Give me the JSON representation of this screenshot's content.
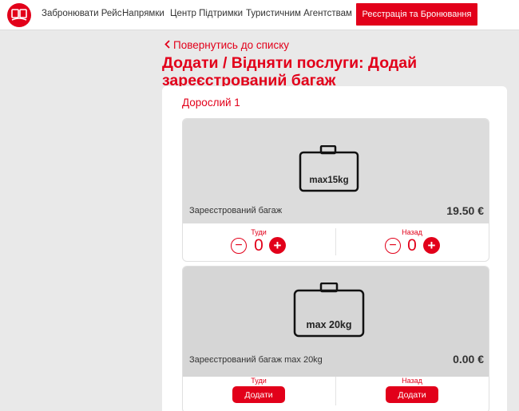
{
  "header": {
    "nav": [
      "Забронювати Рейс",
      "Напрямки",
      "Центр Підтримки",
      "Туристичним Агентствам"
    ],
    "register_button": "Реєстрація та Бронювання",
    "brand_color": "#e2001a"
  },
  "back_link": "Повернутись до списку",
  "page_title": "Додати / Відняти послуги: Додай зареєстрований багаж",
  "passenger_label": "Дорослий 1",
  "bags": [
    {
      "weight_label": "max15kg",
      "name": "Зареєстрований багаж",
      "price": "19.50 €",
      "outbound": {
        "label": "Туди",
        "count": "0"
      },
      "return": {
        "label": "Назад",
        "count": "0"
      }
    },
    {
      "weight_label": "max 20kg",
      "name": "Зареєстрований багаж max 20kg",
      "price": "0.00 €",
      "outbound": {
        "label": "Туди",
        "button": "Додати"
      },
      "return": {
        "label": "Назад",
        "button": "Додати"
      }
    }
  ],
  "icons": [
    "logo-icon",
    "chevron-left-icon",
    "suitcase-icon",
    "minus-icon",
    "plus-icon"
  ]
}
